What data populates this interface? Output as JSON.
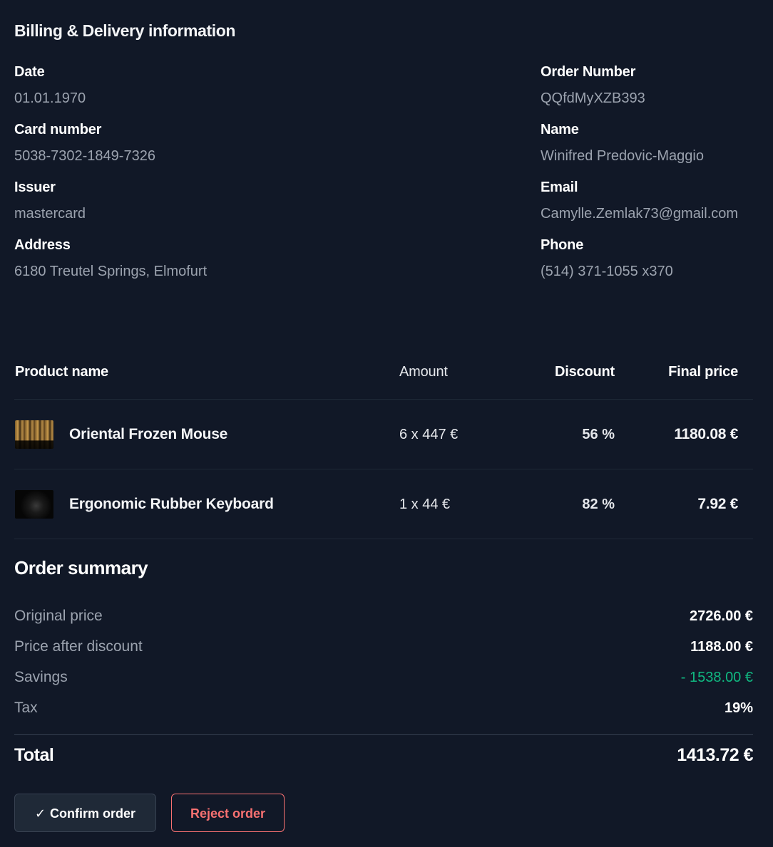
{
  "header": {
    "title": "Billing & Delivery information"
  },
  "billing": {
    "date_label": "Date",
    "date_value": "01.01.1970",
    "card_label": "Card number",
    "card_value": "5038-7302-1849-7326",
    "issuer_label": "Issuer",
    "issuer_value": "mastercard",
    "address_label": "Address",
    "address_value": "6180 Treutel Springs, Elmofurt"
  },
  "delivery": {
    "order_label": "Order Number",
    "order_value": "QQfdMyXZB393",
    "name_label": "Name",
    "name_value": "Winifred Predovic-Maggio",
    "email_label": "Email",
    "email_value": "Camylle.Zemlak73@gmail.com",
    "phone_label": "Phone",
    "phone_value": "(514) 371-1055 x370"
  },
  "table": {
    "columns": {
      "product": "Product name",
      "amount": "Amount",
      "discount": "Discount",
      "final": "Final price"
    },
    "rows": [
      {
        "image_icon": "product-image-icon",
        "name": "Oriental Frozen Mouse",
        "amount": "6 x 447 €",
        "discount": "56 %",
        "final": "1180.08 €"
      },
      {
        "image_icon": "product-image-icon",
        "name": "Ergonomic Rubber Keyboard",
        "amount": "1 x 44 €",
        "discount": "82 %",
        "final": "7.92 €"
      }
    ]
  },
  "summary": {
    "title": "Order summary",
    "original_label": "Original price",
    "original_value": "2726.00 €",
    "after_label": "Price after discount",
    "after_value": "1188.00 €",
    "savings_label": "Savings",
    "savings_value": "- 1538.00 €",
    "tax_label": "Tax",
    "tax_value": "19%",
    "total_label": "Total",
    "total_value": "1413.72 €"
  },
  "actions": {
    "confirm_icon": "check-icon",
    "confirm_label": "Confirm order",
    "reject_label": "Reject order"
  },
  "colors": {
    "background": "#111827",
    "muted_text": "#9ca3af",
    "savings_green": "#10b981",
    "reject_red": "#f87171"
  }
}
